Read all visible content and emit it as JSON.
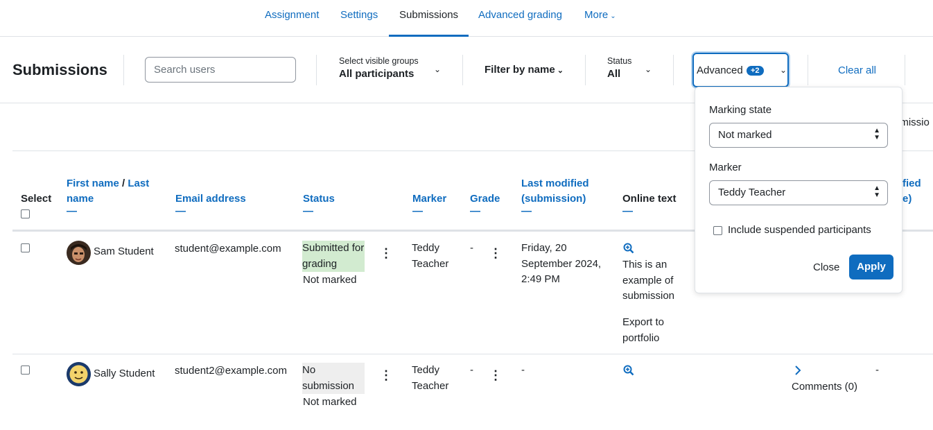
{
  "nav": {
    "tabs": [
      {
        "label": "Assignment"
      },
      {
        "label": "Settings"
      },
      {
        "label": "Submissions"
      },
      {
        "label": "Advanced grading"
      },
      {
        "label": "More"
      }
    ]
  },
  "toolbar": {
    "title": "Submissions",
    "search_placeholder": "Search users",
    "groups_label": "Select visible groups",
    "groups_value": "All participants",
    "filter_by_name": "Filter by name",
    "status_label": "Status",
    "status_value": "All",
    "advanced_label": "Advanced",
    "advanced_badge": "+2",
    "clear_all": "Clear all"
  },
  "action_bar": {
    "partial_text": "bmissio"
  },
  "table": {
    "headers": {
      "select": "Select",
      "first_name": "First name",
      "slash": "/",
      "last_name": "Last name",
      "email": "Email address",
      "status": "Status",
      "marker": "Marker",
      "grade": "Grade",
      "last_modified": "Last modified (submission)",
      "online_text": "Online text",
      "partial_right_1": "fied",
      "partial_right_2": "e)",
      "collapse_symbol": "—"
    },
    "rows": [
      {
        "name": "Sam Student",
        "email": "student@example.com",
        "status_main": "Submitted for grading",
        "status_sub": "Not marked",
        "marker": "Teddy Teacher",
        "grade": "-",
        "last_modified": "Friday, 20 September 2024, 2:49 PM",
        "online_text": "This is an example of submission",
        "export": "Export to portfolio"
      },
      {
        "name": "Sally Student",
        "email": "student2@example.com",
        "status_main": "No submission",
        "status_sub": "Not marked",
        "marker": "Teddy Teacher",
        "grade": "-",
        "last_modified": "-",
        "comments": "Comments (0)",
        "trailing": "-"
      }
    ]
  },
  "popover": {
    "marking_state_label": "Marking state",
    "marking_state_value": "Not marked",
    "marker_label": "Marker",
    "marker_value": "Teddy Teacher",
    "suspended_label": "Include suspended participants",
    "close": "Close",
    "apply": "Apply"
  },
  "colors": {
    "accent": "#0f6cbf",
    "submitted_bg": "#d2ebd0",
    "nosubmission_bg": "#eeeeee"
  }
}
